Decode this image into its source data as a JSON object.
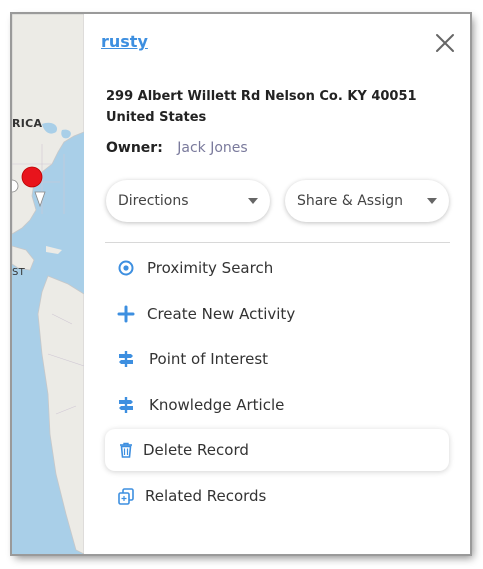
{
  "map": {
    "labels": [
      "RICA",
      "ST"
    ],
    "pin_color": "#e8141c"
  },
  "panel": {
    "title": "rusty",
    "address": "299 Albert Willett Rd Nelson Co. KY 40051 United States",
    "owner_label": "Owner:",
    "owner_value": "Jack Jones",
    "directions_label": "Directions",
    "share_label": "Share & Assign",
    "menu": [
      {
        "label": "Proximity Search",
        "icon": "target-icon"
      },
      {
        "label": "Create New Activity",
        "icon": "plus-icon"
      },
      {
        "label": "Point of Interest",
        "icon": "signpost-icon"
      },
      {
        "label": "Knowledge Article",
        "icon": "signpost-icon"
      },
      {
        "label": "Delete Record",
        "icon": "trash-icon"
      },
      {
        "label": "Related Records",
        "icon": "copy-icon"
      }
    ]
  },
  "colors": {
    "accent": "#3d8fe0",
    "icon": "#3d8fe0"
  }
}
